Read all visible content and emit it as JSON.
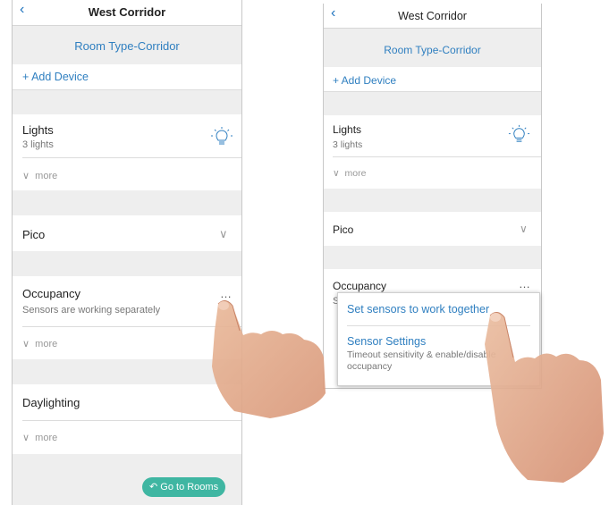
{
  "screen1": {
    "back_icon": "chevron-left-icon",
    "title": "West Corridor",
    "room_type": "Room Type-Corridor",
    "add_device": "+ Add Device",
    "lights": {
      "label": "Lights",
      "sub": "3 lights",
      "more": "more",
      "icon": "lightbulb-icon"
    },
    "pico": {
      "label": "Pico",
      "icon": "chevron-down-icon"
    },
    "occupancy": {
      "label": "Occupancy",
      "sub": "Sensors are working separately",
      "more": "more",
      "icon": "more-dots-icon"
    },
    "daylighting": {
      "label": "Daylighting",
      "more": "more"
    },
    "go_to_rooms": "Go to Rooms"
  },
  "screen2": {
    "back_icon": "chevron-left-icon",
    "title": "West Corridor",
    "room_type": "Room Type-Corridor",
    "add_device": "+ Add Device",
    "lights": {
      "label": "Lights",
      "sub": "3 lights",
      "more": "more",
      "icon": "lightbulb-icon"
    },
    "pico": {
      "label": "Pico",
      "icon": "chevron-down-icon"
    },
    "occupancy": {
      "label": "Occupancy",
      "sub": "S",
      "icon": "more-dots-icon"
    },
    "menu": {
      "item1": "Set sensors to work together",
      "item2_title": "Sensor Settings",
      "item2_sub": "Timeout sensitivity & enable/disable occupancy"
    }
  },
  "colors": {
    "accent": "#2f7fc0",
    "button": "#3fb6a2",
    "band": "#eeeeee"
  }
}
